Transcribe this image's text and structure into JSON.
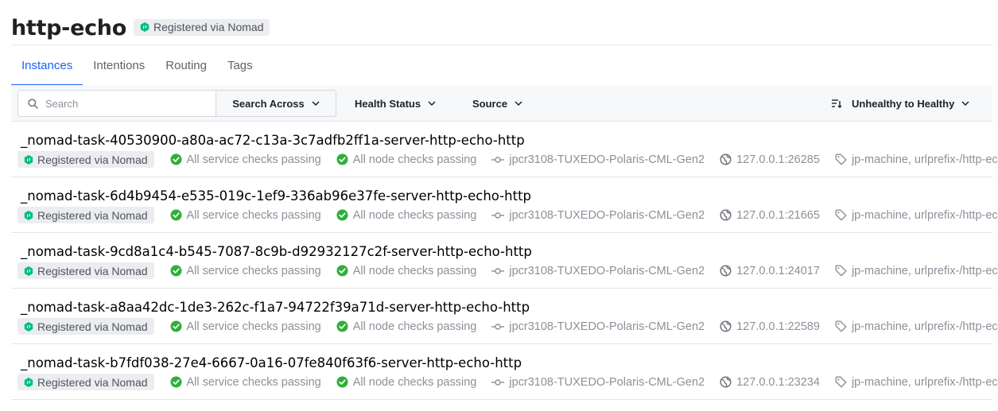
{
  "header": {
    "title": "http-echo",
    "badge": {
      "label": "Registered via Nomad",
      "icon": "nomad-icon"
    }
  },
  "tabs": [
    {
      "label": "Instances",
      "active": true
    },
    {
      "label": "Intentions",
      "active": false
    },
    {
      "label": "Routing",
      "active": false
    },
    {
      "label": "Tags",
      "active": false
    }
  ],
  "toolbar": {
    "search": {
      "placeholder": "Search",
      "value": ""
    },
    "search_across": "Search Across",
    "health_status": "Health Status",
    "source": "Source",
    "sort": "Unhealthy to Healthy"
  },
  "colors": {
    "accent": "#1563ff",
    "passing": "#2eb039",
    "nomad": "#00bc7f",
    "muted": "#8c9099"
  },
  "instances": [
    {
      "name": "_nomad-task-40530900-a80a-ac72-c13a-3c7adfb2ff1a-server-http-echo-http",
      "source": "Registered via Nomad",
      "service_checks": "All service checks passing",
      "node_checks": "All node checks passing",
      "node": "jpcr3108-TUXEDO-Polaris-CML-Gen2",
      "address": "127.0.0.1:26285",
      "tags": "jp-machine, urlprefix-/http-echo"
    },
    {
      "name": "_nomad-task-6d4b9454-e535-019c-1ef9-336ab96e37fe-server-http-echo-http",
      "source": "Registered via Nomad",
      "service_checks": "All service checks passing",
      "node_checks": "All node checks passing",
      "node": "jpcr3108-TUXEDO-Polaris-CML-Gen2",
      "address": "127.0.0.1:21665",
      "tags": "jp-machine, urlprefix-/http-echo"
    },
    {
      "name": "_nomad-task-9cd8a1c4-b545-7087-8c9b-d92932127c2f-server-http-echo-http",
      "source": "Registered via Nomad",
      "service_checks": "All service checks passing",
      "node_checks": "All node checks passing",
      "node": "jpcr3108-TUXEDO-Polaris-CML-Gen2",
      "address": "127.0.0.1:24017",
      "tags": "jp-machine, urlprefix-/http-echo"
    },
    {
      "name": "_nomad-task-a8aa42dc-1de3-262c-f1a7-94722f39a71d-server-http-echo-http",
      "source": "Registered via Nomad",
      "service_checks": "All service checks passing",
      "node_checks": "All node checks passing",
      "node": "jpcr3108-TUXEDO-Polaris-CML-Gen2",
      "address": "127.0.0.1:22589",
      "tags": "jp-machine, urlprefix-/http-echo"
    },
    {
      "name": "_nomad-task-b7fdf038-27e4-6667-0a16-07fe840f63f6-server-http-echo-http",
      "source": "Registered via Nomad",
      "service_checks": "All service checks passing",
      "node_checks": "All node checks passing",
      "node": "jpcr3108-TUXEDO-Polaris-CML-Gen2",
      "address": "127.0.0.1:23234",
      "tags": "jp-machine, urlprefix-/http-echo"
    }
  ]
}
